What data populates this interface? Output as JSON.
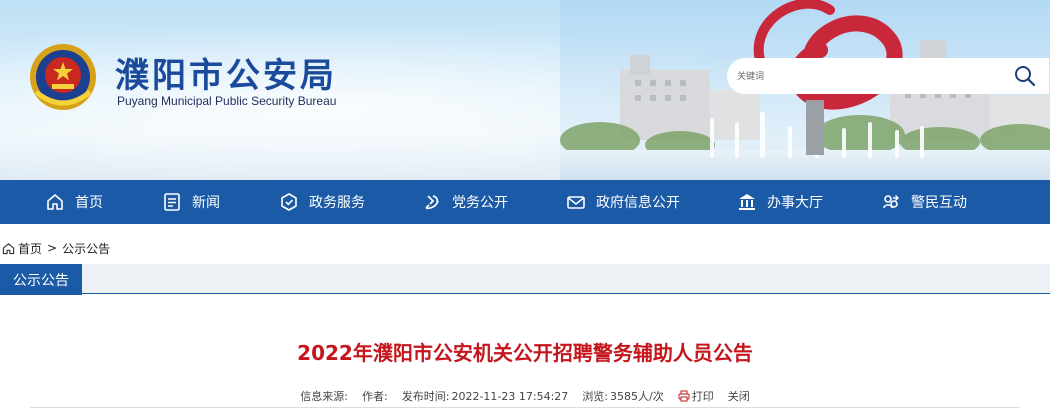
{
  "header": {
    "title": "濮阳市公安局",
    "subtitle": "Puyang Municipal Public Security Bureau",
    "emblem_icon": "police-emblem-icon",
    "search": {
      "placeholder": "关键词",
      "icon": "search-icon"
    }
  },
  "nav": {
    "items": [
      {
        "label": "首页",
        "icon": "home-icon"
      },
      {
        "label": "新闻",
        "icon": "news-icon"
      },
      {
        "label": "政务服务",
        "icon": "service-icon"
      },
      {
        "label": "党务公开",
        "icon": "party-icon"
      },
      {
        "label": "政府信息公开",
        "icon": "mail-icon"
      },
      {
        "label": "办事大厅",
        "icon": "hall-icon"
      },
      {
        "label": "警民互动",
        "icon": "interaction-icon"
      }
    ]
  },
  "breadcrumb": {
    "home": "首页",
    "separator": ">",
    "current": "公示公告"
  },
  "section": {
    "label": "公示公告"
  },
  "article": {
    "title": "2022年濮阳市公安机关公开招聘警务辅助人员公告",
    "meta": {
      "source_label": "信息来源:",
      "author_label": "作者:",
      "published_label": "发布时间:",
      "published_value": "2022-11-23 17:54:27",
      "views_label": "浏览:",
      "views_value": "3585人/次",
      "print_label": "打印",
      "close_label": "关闭"
    }
  },
  "colors": {
    "brand_blue": "#1b5aa6",
    "title_red": "#c4161c",
    "title_blue": "#1a4a9c"
  }
}
